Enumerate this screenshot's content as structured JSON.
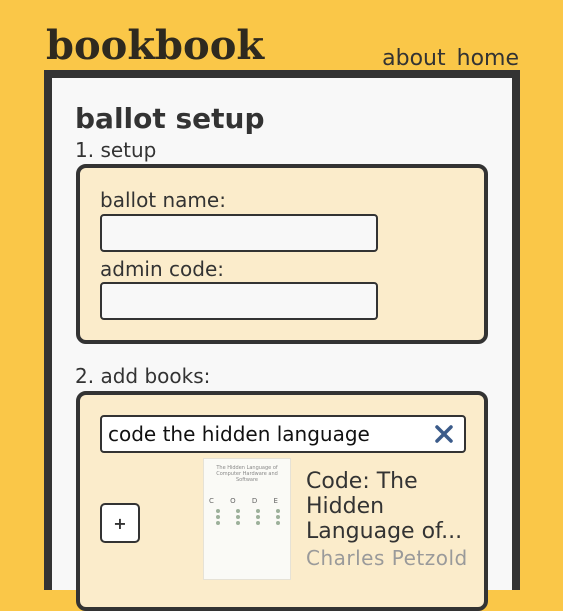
{
  "site": {
    "title": "bookbook"
  },
  "nav": {
    "items": [
      {
        "label": "about"
      },
      {
        "label": "home"
      }
    ]
  },
  "page": {
    "title": "ballot setup"
  },
  "setup": {
    "step_label": "1. setup",
    "ballot_name_label": "ballot name:",
    "ballot_name_value": "",
    "admin_code_label": "admin code:",
    "admin_code_value": ""
  },
  "add_books": {
    "step_label": "2. add books:",
    "search_value": "code the hidden language",
    "clear_icon": "close-icon",
    "add_button_label": "+",
    "results": [
      {
        "title": "Code: The Hidden Language of...",
        "author": "Charles Petzold",
        "cover_caption": "The Hidden Language of Computer Hardware and Software",
        "cover_letters": "C O D E"
      }
    ]
  },
  "colors": {
    "background": "#fac748",
    "panel": "#f8f8f8",
    "card": "#fbeccb",
    "border": "#333333",
    "clear_icon": "#3b5b8a",
    "author_text": "#9a9a9a"
  }
}
